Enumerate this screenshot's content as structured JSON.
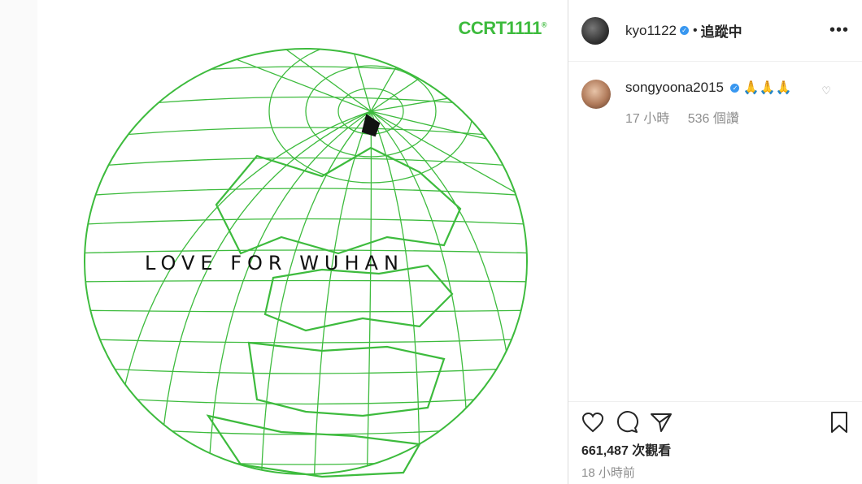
{
  "post": {
    "brand_text": "CCRT1111",
    "brand_mark": "®",
    "headline": "LOVE FOR WUHAN",
    "globe_color": "#3dbb3d"
  },
  "header": {
    "username": "kyo1122",
    "separator": "•",
    "follow_status": "追蹤中",
    "more_label": "•••"
  },
  "comment": {
    "username": "songyoona2015",
    "text": "🙏🙏🙏",
    "time": "17 小時",
    "likes": "536 個讚"
  },
  "footer": {
    "views": "661,487 次觀看",
    "time_ago": "18 小時前"
  },
  "colors": {
    "verified": "#3897f0",
    "muted_text": "#8e8e8e",
    "brand_green": "#3dbb3d"
  }
}
